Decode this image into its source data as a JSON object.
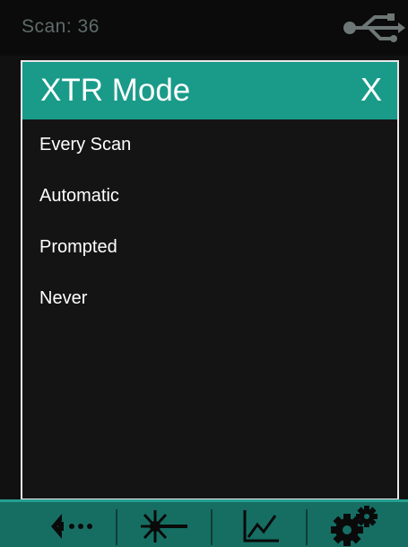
{
  "status_bar": {
    "scan_label": "Scan: 36",
    "usb_icon": "usb-icon"
  },
  "dialog": {
    "title": "XTR Mode",
    "close_label": "X",
    "options": [
      {
        "label": "Every Scan"
      },
      {
        "label": "Automatic"
      },
      {
        "label": "Prompted"
      },
      {
        "label": "Never"
      }
    ]
  },
  "toolbar": {
    "items": [
      {
        "icon": "back-icon"
      },
      {
        "icon": "laser-icon"
      },
      {
        "icon": "chart-icon"
      },
      {
        "icon": "settings-icon"
      }
    ]
  },
  "colors": {
    "accent": "#1a9b8a",
    "toolbar": "#166e63",
    "background": "#141414",
    "muted_text": "#5f6b69"
  }
}
